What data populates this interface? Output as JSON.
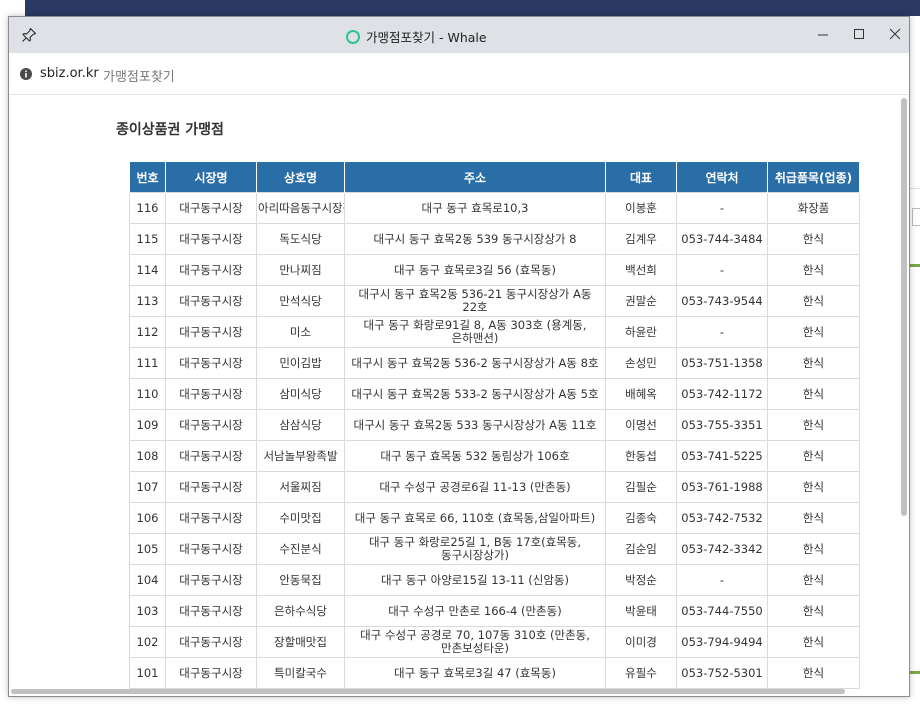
{
  "window": {
    "title": "가맹점포찾기 - Whale",
    "address_host": "sbiz.or.kr",
    "address_page": "가맹점포찾기"
  },
  "page": {
    "heading": "종이상품권 가맹점"
  },
  "table": {
    "headers": [
      "번호",
      "시장명",
      "상호명",
      "주소",
      "대표",
      "연락처",
      "취급품목(업종)"
    ],
    "rows": [
      [
        "116",
        "대구동구시장",
        "아리따음동구시장점",
        "대구 동구 효목로10,3",
        "이봉훈",
        "-",
        "화장품"
      ],
      [
        "115",
        "대구동구시장",
        "독도식당",
        "대구시 동구 효목2동 539 동구시장상가 8",
        "김계우",
        "053-744-3484",
        "한식"
      ],
      [
        "114",
        "대구동구시장",
        "만나찌짐",
        "대구 동구 효목로3길 56 (효목동)",
        "백선희",
        "-",
        "한식"
      ],
      [
        "113",
        "대구동구시장",
        "만석식당",
        "대구시 동구 효목2동 536-21 동구시장상가 A동 22호",
        "권말순",
        "053-743-9544",
        "한식"
      ],
      [
        "112",
        "대구동구시장",
        "미소",
        "대구 동구 화랑로91길 8, A동 303호 (용계동,은하맨션)",
        "하윤란",
        "-",
        "한식"
      ],
      [
        "111",
        "대구동구시장",
        "민이김밥",
        "대구시 동구 효목2동 536-2 동구시장상가 A동 8호",
        "손성민",
        "053-751-1358",
        "한식"
      ],
      [
        "110",
        "대구동구시장",
        "삼미식당",
        "대구시 동구 효목2동 533-2 동구시장상가 A동 5호",
        "배혜옥",
        "053-742-1172",
        "한식"
      ],
      [
        "109",
        "대구동구시장",
        "삼삼식당",
        "대구시 동구 효목2동 533 동구시장상가 A동 11호",
        "이명선",
        "053-755-3351",
        "한식"
      ],
      [
        "108",
        "대구동구시장",
        "서남놀부왕족발",
        "대구 동구 효목동 532 동림상가 106호",
        "한동섭",
        "053-741-5225",
        "한식"
      ],
      [
        "107",
        "대구동구시장",
        "서울찌짐",
        "대구 수성구 공경로6길 11-13 (만촌동)",
        "김필순",
        "053-761-1988",
        "한식"
      ],
      [
        "106",
        "대구동구시장",
        "수미맛집",
        "대구 동구 효목로 66, 110호 (효목동,삼일아파트)",
        "김종숙",
        "053-742-7532",
        "한식"
      ],
      [
        "105",
        "대구동구시장",
        "수진분식",
        "대구 동구 화랑로25길 1, B동 17호(효목동, 동구시장상가)",
        "김순임",
        "053-742-3342",
        "한식"
      ],
      [
        "104",
        "대구동구시장",
        "안동묵집",
        "대구 동구 아양로15길 13-11 (신암동)",
        "박정순",
        "-",
        "한식"
      ],
      [
        "103",
        "대구동구시장",
        "은하수식당",
        "대구 수성구 만촌로 166-4 (만촌동)",
        "박윤태",
        "053-744-7550",
        "한식"
      ],
      [
        "102",
        "대구동구시장",
        "장할매맛집",
        "대구 수성구 공경로 70, 107동 310호 (만촌동,만촌보성타운)",
        "이미경",
        "053-794-9494",
        "한식"
      ],
      [
        "101",
        "대구동구시장",
        "특미칼국수",
        "대구 동구 효목로3길 47 (효목동)",
        "유필수",
        "053-752-5301",
        "한식"
      ]
    ]
  }
}
